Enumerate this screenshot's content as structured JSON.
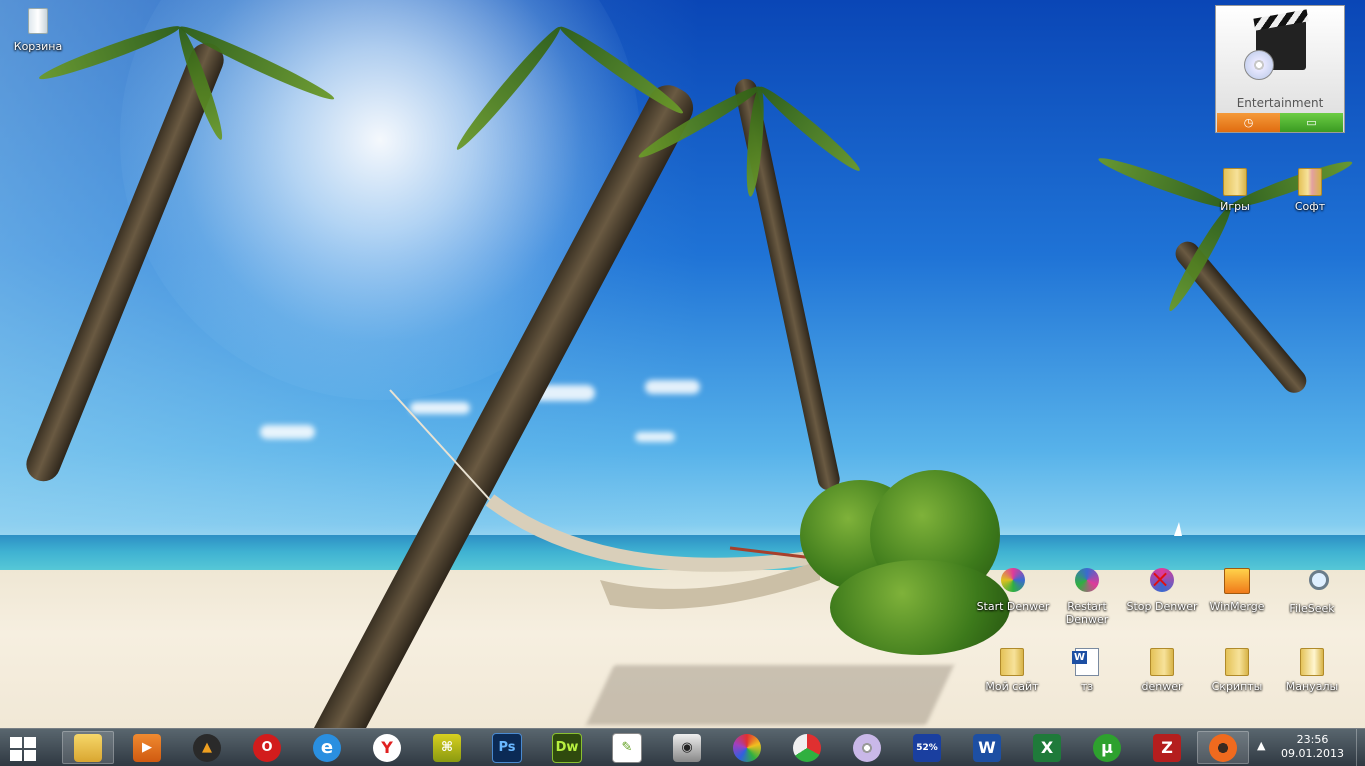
{
  "desktop": {
    "icons": {
      "recycle_bin": "Корзина",
      "games": "Игры",
      "soft": "Софт",
      "start_denwer": "Start Denwer",
      "restart_denwer": "Restart Denwer",
      "stop_denwer": "Stop Denwer",
      "winmerge": "WinMerge",
      "fileseek": "FileSeek",
      "my_site": "Мой сайт",
      "tz": "тз",
      "denwer": "denwer",
      "scripts": "Скрипты",
      "manuals": "Мануалы"
    }
  },
  "gadget": {
    "title": "Entertainment"
  },
  "taskbar": {
    "apps": [
      {
        "icon": "file-explorer-icon",
        "label": ""
      },
      {
        "icon": "media-player-icon",
        "label": ""
      },
      {
        "icon": "aimp-icon",
        "label": ""
      },
      {
        "icon": "opera-icon",
        "label": "O"
      },
      {
        "icon": "internet-explorer-icon",
        "label": "e"
      },
      {
        "icon": "yandex-browser-icon",
        "label": "Y"
      },
      {
        "icon": "network-icon",
        "label": ""
      },
      {
        "icon": "photoshop-icon",
        "label": "Ps"
      },
      {
        "icon": "dreamweaver-icon",
        "label": "Dw"
      },
      {
        "icon": "notepad-plus-plus-icon",
        "label": ""
      },
      {
        "icon": "speaker-icon",
        "label": ""
      },
      {
        "icon": "picasa-icon",
        "label": ""
      },
      {
        "icon": "kingsoft-icon",
        "label": ""
      },
      {
        "icon": "dvd-icon",
        "label": ""
      },
      {
        "icon": "speedtest-icon",
        "label": "52%"
      },
      {
        "icon": "word-icon",
        "label": "W"
      },
      {
        "icon": "excel-icon",
        "label": "X"
      },
      {
        "icon": "utorrent-icon",
        "label": "µ"
      },
      {
        "icon": "filezilla-icon",
        "label": "Z"
      },
      {
        "icon": "origin-icon",
        "label": ""
      }
    ],
    "clock": {
      "time": "23:56",
      "date": "09.01.2013"
    }
  },
  "colors": {
    "taskbar": "#2a3540",
    "sky": "#1f73d6",
    "sand": "#f3ecdc",
    "photoshop": "#0b2a55",
    "dreamweaver": "#2f4a0e",
    "word": "#1d4fa3",
    "excel": "#1f7a3a",
    "filezilla": "#b41e1e",
    "utorrent": "#2ea12e",
    "opera": "#d21c1c",
    "origin": "#f06a1e"
  }
}
